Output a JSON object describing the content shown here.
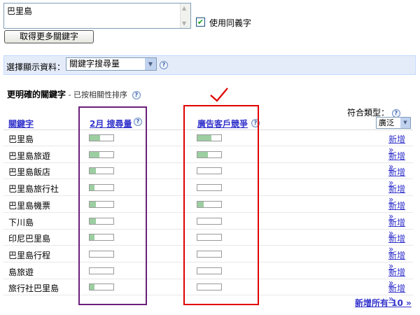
{
  "query": {
    "value": "巴里島",
    "scroll_up_icon": "triangle-up",
    "scroll_down_icon": "triangle-down",
    "synonyms_checked": true,
    "synonyms_label": "使用同義字",
    "more_button": "取得更多關鍵字"
  },
  "filter": {
    "label": "選擇顯示資料：",
    "selected": "關鍵字搜尋量"
  },
  "results": {
    "title": "更明確的關鍵字",
    "subtitle": " - 已按相關性排序",
    "match_type_label": "符合類型：",
    "match_type_value": "廣泛",
    "columns": {
      "keyword": "關鍵字",
      "volume": "2月 搜尋量",
      "competition": "廣告客戶競爭"
    },
    "add_label": "新增 »",
    "add_all_label": "新增所有 10 »",
    "bar_color": "#9ccea2",
    "rows": [
      {
        "keyword": "巴里島",
        "volume": 0.45,
        "competition": 0.6
      },
      {
        "keyword": "巴里島旅遊",
        "volume": 0.4,
        "competition": 0.45
      },
      {
        "keyword": "巴里島飯店",
        "volume": 0.25,
        "competition": 0.0
      },
      {
        "keyword": "巴里島旅行社",
        "volume": 0.2,
        "competition": 0.0
      },
      {
        "keyword": "巴里島機票",
        "volume": 0.25,
        "competition": 0.25
      },
      {
        "keyword": "下川島",
        "volume": 0.25,
        "competition": 0.0
      },
      {
        "keyword": "印尼巴里島",
        "volume": 0.2,
        "competition": 0.0
      },
      {
        "keyword": "巴里島行程",
        "volume": 0.0,
        "competition": 0.0
      },
      {
        "keyword": "島旅遊",
        "volume": 0.0,
        "competition": 0.0
      },
      {
        "keyword": "旅行社巴里島",
        "volume": 0.2,
        "competition": 0.0
      }
    ]
  },
  "annotations": {
    "volume_box_color": "#6b1f7c",
    "competition_box_color": "#e00000"
  }
}
